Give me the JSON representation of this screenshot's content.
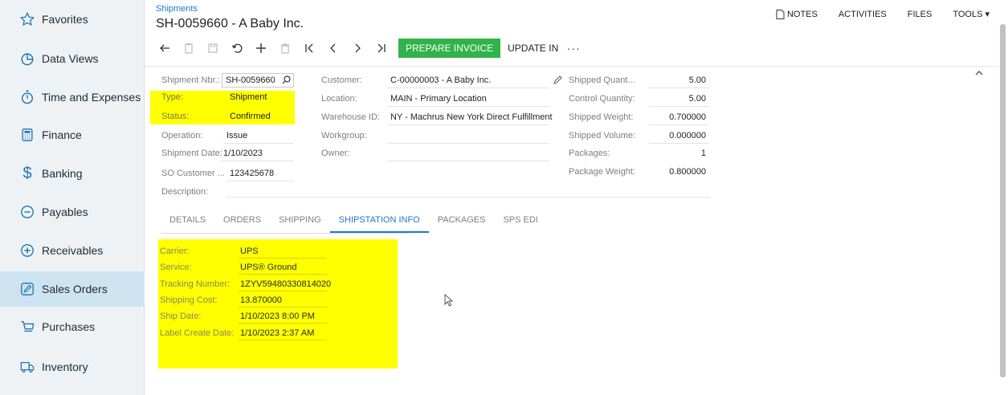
{
  "sidebar": {
    "items": [
      {
        "label": "Favorites",
        "icon": "star-icon"
      },
      {
        "label": "Data Views",
        "icon": "pie-chart-icon"
      },
      {
        "label": "Time and Expenses",
        "icon": "stopwatch-icon"
      },
      {
        "label": "Finance",
        "icon": "calculator-icon"
      },
      {
        "label": "Banking",
        "icon": "dollar-icon"
      },
      {
        "label": "Payables",
        "icon": "minus-circle-icon"
      },
      {
        "label": "Receivables",
        "icon": "plus-circle-icon"
      },
      {
        "label": "Sales Orders",
        "icon": "pencil-square-icon",
        "active": true
      },
      {
        "label": "Purchases",
        "icon": "cart-icon"
      },
      {
        "label": "Inventory",
        "icon": "truck-icon"
      }
    ]
  },
  "header": {
    "breadcrumb": "Shipments",
    "title": "SH-0059660 - A Baby Inc."
  },
  "toolbar": {
    "prepare_invoice": "PREPARE INVOICE",
    "update_in": "UPDATE IN",
    "more": "···"
  },
  "top_links": {
    "notes": "NOTES",
    "activities": "ACTIVITIES",
    "files": "FILES",
    "tools": "TOOLS ▾"
  },
  "form": {
    "shipment_nbr": {
      "label": "Shipment Nbr.:",
      "value": "SH-0059660"
    },
    "type": {
      "label": "Type:",
      "value": "Shipment"
    },
    "status": {
      "label": "Status:",
      "value": "Confirmed"
    },
    "operation": {
      "label": "Operation:",
      "value": "Issue"
    },
    "shipment_date": {
      "label": "Shipment Date:",
      "value": "1/10/2023"
    },
    "so_customer": {
      "label": "SO Customer ...",
      "value": "123425678"
    },
    "description": {
      "label": "Description:",
      "value": ""
    },
    "customer": {
      "label": "Customer:",
      "value": "C-00000003 - A Baby Inc."
    },
    "location": {
      "label": "Location:",
      "value": "MAIN - Primary Location"
    },
    "warehouse": {
      "label": "Warehouse ID:",
      "value": "NY - Machrus New York Direct Fulfillment"
    },
    "workgroup": {
      "label": "Workgroup:",
      "value": ""
    },
    "owner": {
      "label": "Owner:",
      "value": ""
    },
    "shipped_quantity": {
      "label": "Shipped Quant...",
      "value": "5.00"
    },
    "control_quantity": {
      "label": "Control Quantity:",
      "value": "5.00"
    },
    "shipped_weight": {
      "label": "Shipped Weight:",
      "value": "0.700000"
    },
    "shipped_volume": {
      "label": "Shipped Volume:",
      "value": "0.000000"
    },
    "packages": {
      "label": "Packages:",
      "value": "1"
    },
    "package_weight": {
      "label": "Package Weight:",
      "value": "0.800000"
    }
  },
  "tabs": [
    {
      "label": "DETAILS"
    },
    {
      "label": "ORDERS"
    },
    {
      "label": "SHIPPING"
    },
    {
      "label": "SHIPSTATION INFO",
      "active": true
    },
    {
      "label": "PACKAGES"
    },
    {
      "label": "SPS EDI"
    }
  ],
  "shipstation": [
    {
      "label": "Carrier:",
      "value": "UPS"
    },
    {
      "label": "Service:",
      "value": "UPS® Ground"
    },
    {
      "label": "Tracking Number:",
      "value": "1ZYV59480330814020"
    },
    {
      "label": "Shipping Cost:",
      "value": "13.870000"
    },
    {
      "label": "Ship Date:",
      "value": "1/10/2023 8:00 PM"
    },
    {
      "label": "Label Create Date:",
      "value": "1/10/2023 2:37 AM"
    }
  ],
  "colors": {
    "accent": "#1f77d0",
    "primary_button": "#31b34a",
    "highlight": "#ffff00",
    "sidebar_bg": "#eef2f5",
    "sidebar_active": "#cde3f0"
  }
}
